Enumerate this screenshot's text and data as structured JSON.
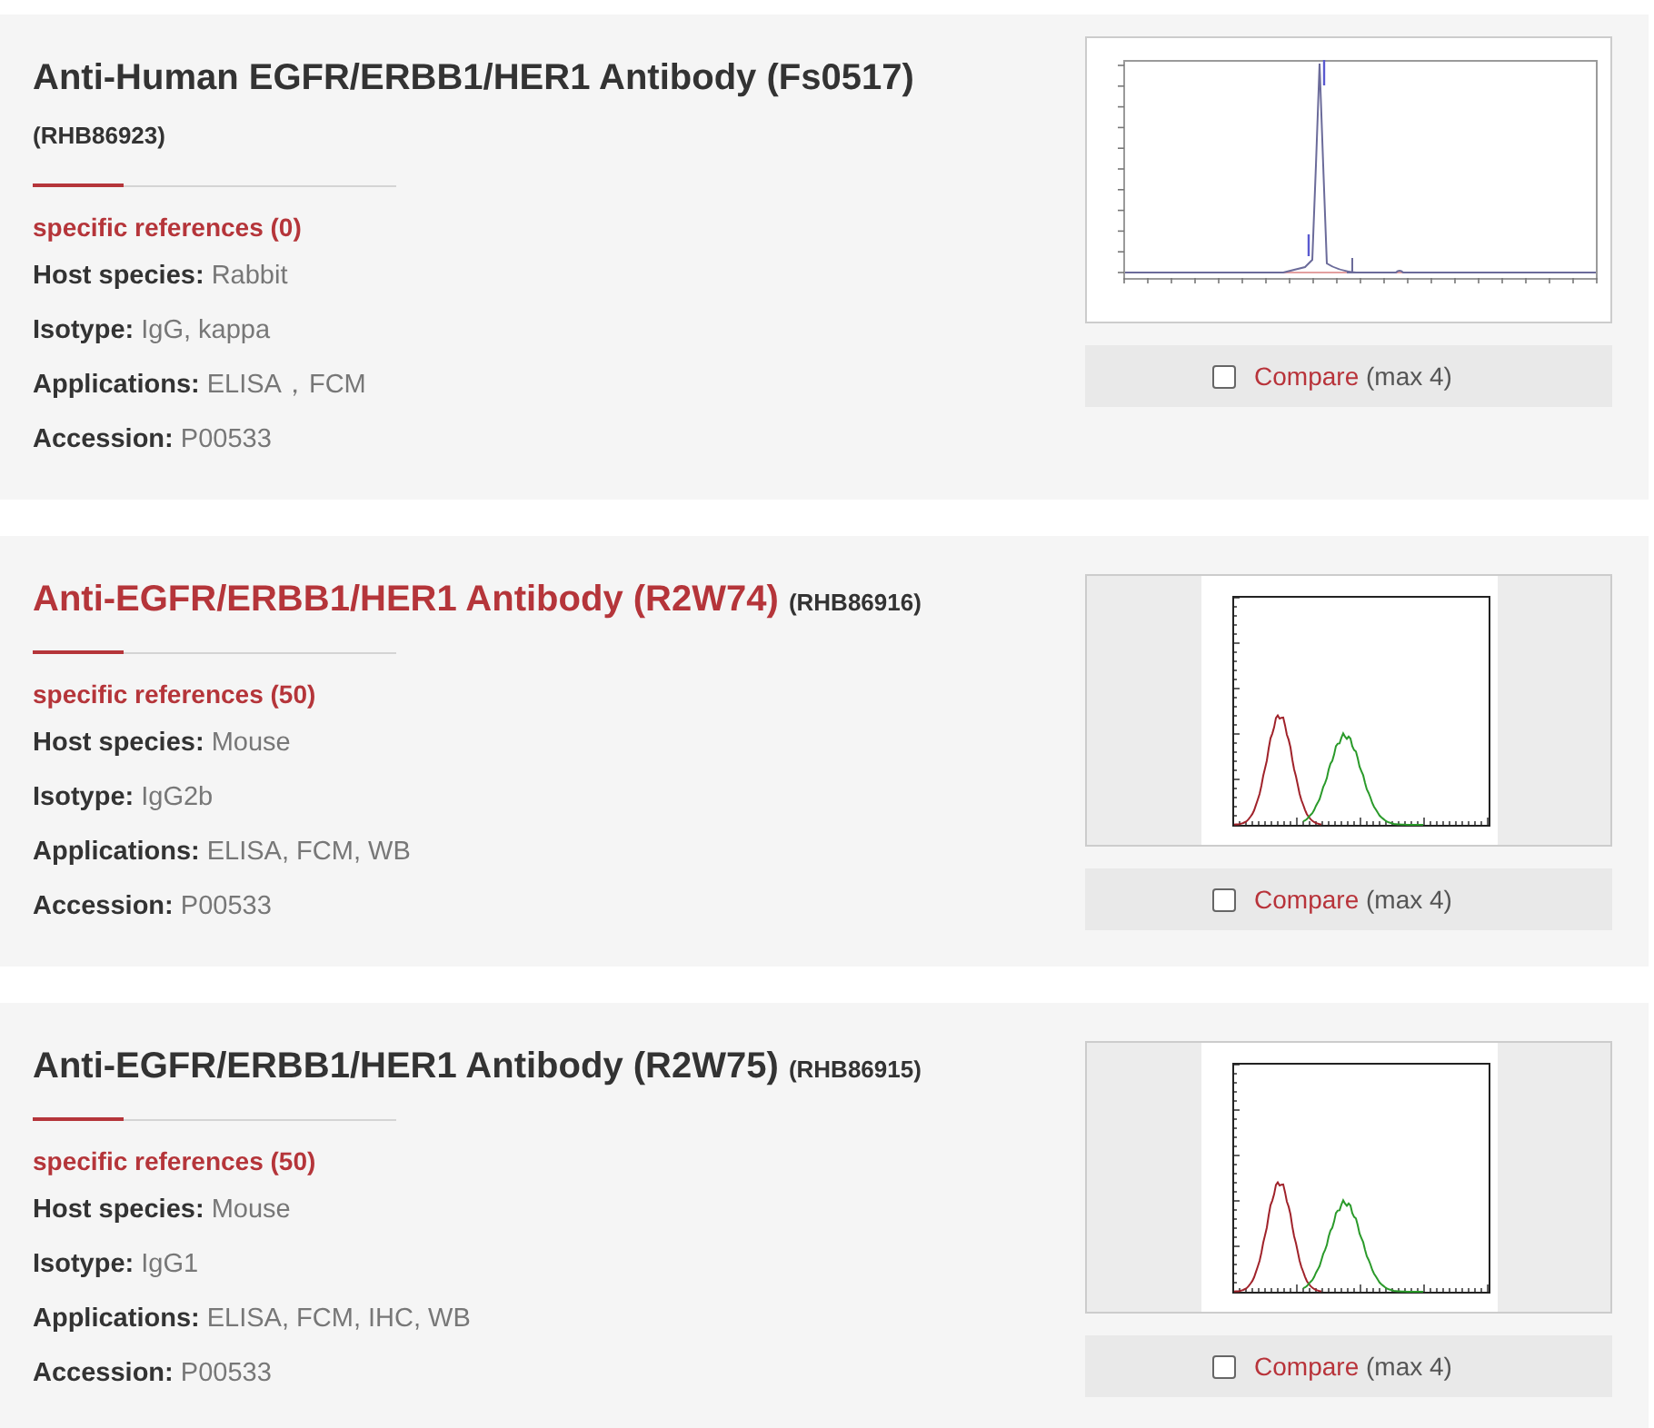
{
  "products": [
    {
      "title": "Anti-Human EGFR/ERBB1/HER1 Antibody (Fs0517)",
      "catalog": "(RHB86923)",
      "highlighted": false,
      "references": "specific references (0)",
      "specs": [
        {
          "label": "Host species:",
          "value": "Rabbit"
        },
        {
          "label": "Isotype:",
          "value": "IgG, kappa"
        },
        {
          "label": "Applications:",
          "value": "ELISA，FCM"
        },
        {
          "label": "Accession:",
          "value": "P00533"
        }
      ],
      "image": {
        "kind": "chromatogram"
      },
      "compare": {
        "checked": false,
        "label": "Compare",
        "note": "(max 4)"
      }
    },
    {
      "title": "Anti-EGFR/ERBB1/HER1 Antibody (R2W74)",
      "catalog": "(RHB86916)",
      "highlighted": true,
      "references": "specific references (50)",
      "specs": [
        {
          "label": "Host species:",
          "value": "Mouse"
        },
        {
          "label": "Isotype:",
          "value": "IgG2b"
        },
        {
          "label": "Applications:",
          "value": "ELISA, FCM, WB"
        },
        {
          "label": "Accession:",
          "value": "P00533"
        }
      ],
      "image": {
        "kind": "histogram"
      },
      "compare": {
        "checked": false,
        "label": "Compare",
        "note": "(max 4)"
      }
    },
    {
      "title": "Anti-EGFR/ERBB1/HER1 Antibody (R2W75)",
      "catalog": "(RHB86915)",
      "highlighted": false,
      "references": "specific references (50)",
      "specs": [
        {
          "label": "Host species:",
          "value": "Mouse"
        },
        {
          "label": "Isotype:",
          "value": "IgG1"
        },
        {
          "label": "Applications:",
          "value": "ELISA, FCM, IHC, WB"
        },
        {
          "label": "Accession:",
          "value": "P00533"
        }
      ],
      "image": {
        "kind": "histogram"
      },
      "compare": {
        "checked": false,
        "label": "Compare",
        "note": "(max 4)"
      }
    }
  ]
}
